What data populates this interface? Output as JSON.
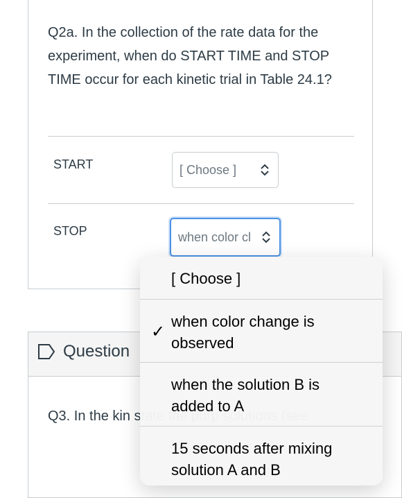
{
  "question": {
    "text": "Q2a. In the collection of the rate data for the experiment, when do START TIME and STOP TIME occur for each kinetic trial in Table 24.1?",
    "rows": [
      {
        "label": "START",
        "value": "[ Choose ]"
      },
      {
        "label": "STOP",
        "value": "when color cl"
      }
    ]
  },
  "next_question": {
    "title": "Question",
    "text": "Q3. In the kin state the purp solutions (see"
  },
  "dropdown": {
    "options": [
      {
        "label": "[ Choose ]",
        "selected": false
      },
      {
        "label": "when color change is observed",
        "selected": true
      },
      {
        "label": "when the solution B is added to A",
        "selected": false
      },
      {
        "label": "15 seconds after mixing solution A and B",
        "selected": false
      }
    ],
    "check": "✓"
  },
  "icons": {
    "chevron": "chevron-up-down-icon",
    "question": "question-flag-icon"
  },
  "colors": {
    "text": "#2d3b45",
    "border": "#c7cdd1",
    "focus": "#4a90e2"
  }
}
